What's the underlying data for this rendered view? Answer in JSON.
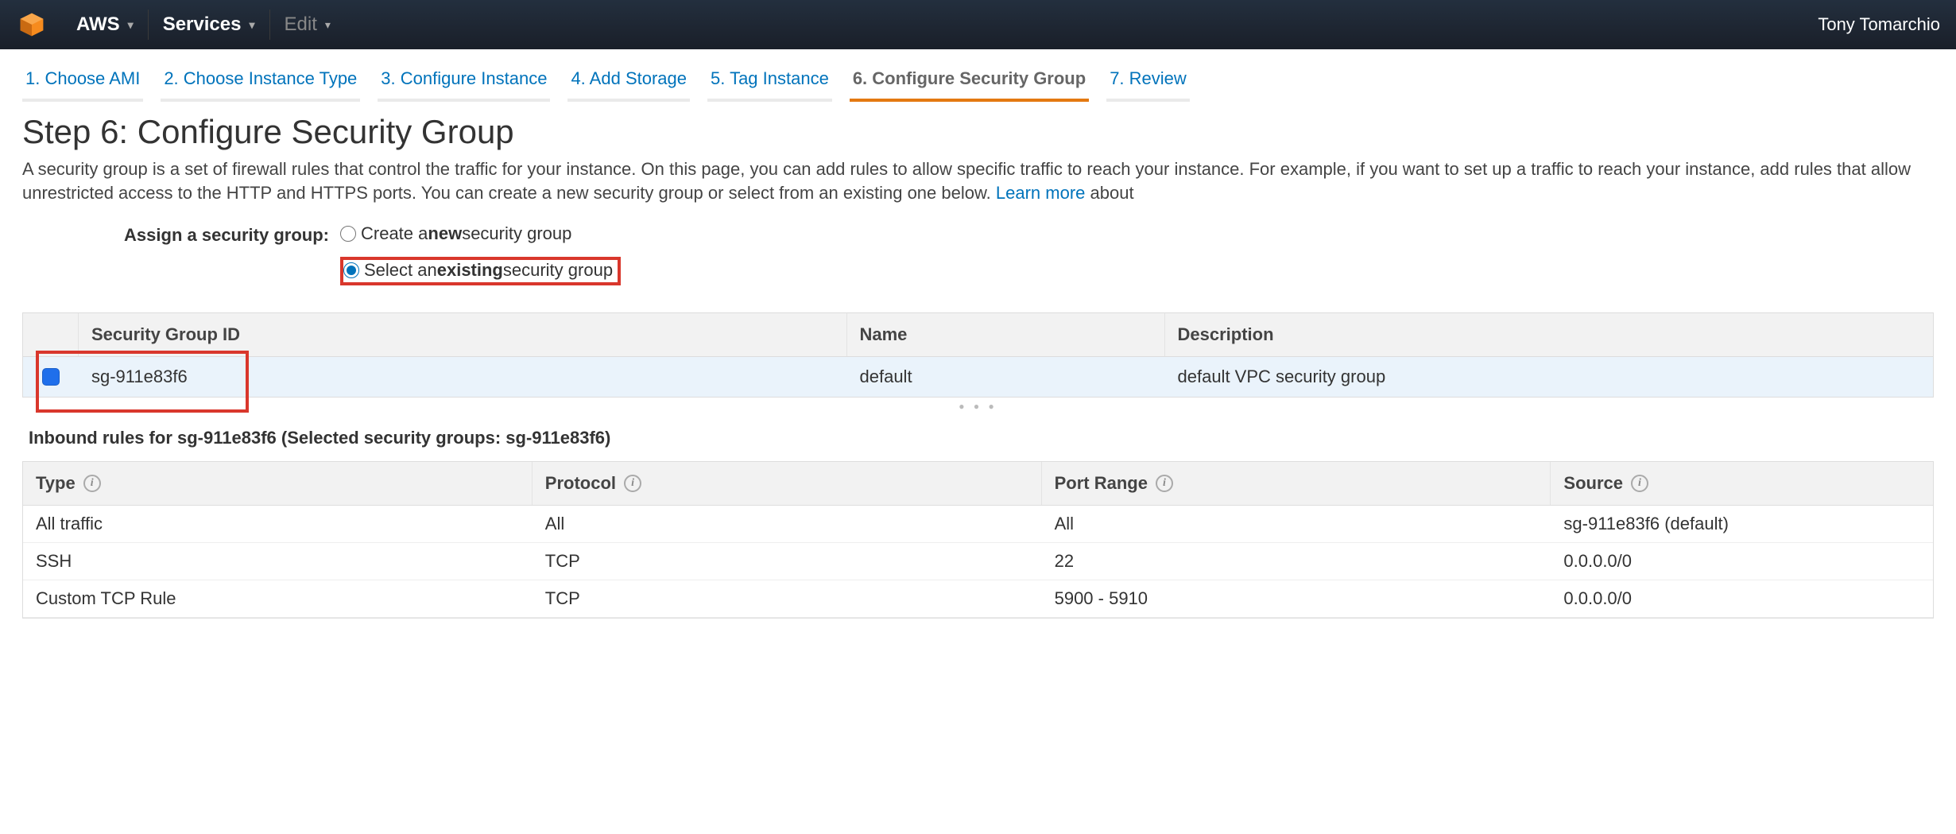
{
  "nav": {
    "brand": "AWS",
    "services": "Services",
    "edit": "Edit",
    "user": "Tony Tomarchio"
  },
  "wizard": [
    {
      "label": "1. Choose AMI"
    },
    {
      "label": "2. Choose Instance Type"
    },
    {
      "label": "3. Configure Instance"
    },
    {
      "label": "4. Add Storage"
    },
    {
      "label": "5. Tag Instance"
    },
    {
      "label": "6. Configure Security Group"
    },
    {
      "label": "7. Review"
    }
  ],
  "wizard_active_index": 5,
  "page": {
    "title": "Step 6: Configure Security Group",
    "desc_pre": "A security group is a set of firewall rules that control the traffic for your instance. On this page, you can add rules to allow specific traffic to reach your instance. For example, if you want to set up a traffic to reach your instance, add rules that allow unrestricted access to the HTTP and HTTPS ports. You can create a new security group or select from an existing one below. ",
    "learn_more": "Learn more",
    "desc_post": " about"
  },
  "assign": {
    "label": "Assign a security group:",
    "create_pre": "Create a ",
    "create_bold": "new",
    "create_post": " security group",
    "select_pre": "Select an ",
    "select_bold": "existing",
    "select_post": " security group",
    "selected": "existing"
  },
  "sg_table": {
    "headers": {
      "id": "Security Group ID",
      "name": "Name",
      "desc": "Description"
    },
    "rows": [
      {
        "checked": true,
        "id": "sg-911e83f6",
        "name": "default",
        "desc": "default VPC security group"
      }
    ]
  },
  "inbound": {
    "title": "Inbound rules for sg-911e83f6 (Selected security groups: sg-911e83f6)",
    "headers": {
      "type": "Type",
      "protocol": "Protocol",
      "port": "Port Range",
      "source": "Source"
    },
    "rows": [
      {
        "type": "All traffic",
        "protocol": "All",
        "port": "All",
        "source": "sg-911e83f6 (default)"
      },
      {
        "type": "SSH",
        "protocol": "TCP",
        "port": "22",
        "source": "0.0.0.0/0"
      },
      {
        "type": "Custom TCP Rule",
        "protocol": "TCP",
        "port": "5900 - 5910",
        "source": "0.0.0.0/0"
      }
    ]
  }
}
